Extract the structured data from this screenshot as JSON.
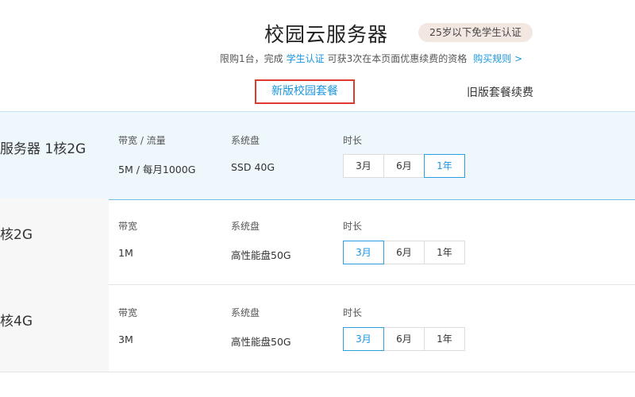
{
  "header": {
    "title": "校园云服务器",
    "badge": "25岁以下免学生认证",
    "subline": {
      "pre": "限购1台，完成",
      "link1": "学生认证",
      "post": "可获3次在本页面优惠续费的资格",
      "link2": "购买规则 >"
    }
  },
  "tabs": {
    "new": "新版校园套餐",
    "old": "旧版套餐续费"
  },
  "plans": [
    {
      "name": "服务器 1核2G",
      "bandwidth_label": "带宽 / 流量",
      "bandwidth_value": "5M / 每月1000G",
      "disk_label": "系统盘",
      "disk_value": "SSD 40G",
      "duration_label": "时长",
      "options": [
        "3月",
        "6月",
        "1年"
      ],
      "selected": "1年"
    },
    {
      "name": "核2G",
      "bandwidth_label": "带宽",
      "bandwidth_value": "1M",
      "disk_label": "系统盘",
      "disk_value": "高性能盘50G",
      "duration_label": "时长",
      "options": [
        "3月",
        "6月",
        "1年"
      ],
      "selected": "3月"
    },
    {
      "name": "核4G",
      "bandwidth_label": "带宽",
      "bandwidth_value": "3M",
      "disk_label": "系统盘",
      "disk_value": "高性能盘50G",
      "duration_label": "时长",
      "options": [
        "3月",
        "6月",
        "1年"
      ],
      "selected": "3月"
    }
  ],
  "colors": {
    "accent": "#1a96e0",
    "tab_highlight_border": "#e0392f",
    "badge_bg": "#f3e7e2",
    "selected_card_bg": "#eef7fc"
  }
}
